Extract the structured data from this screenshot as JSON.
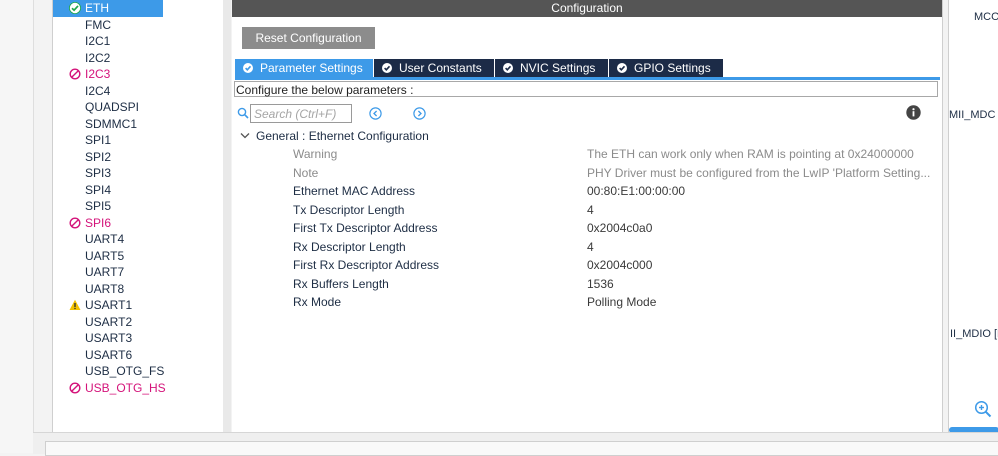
{
  "sidebar": {
    "items": [
      {
        "label": "ETH",
        "state": "selected",
        "icon": "check-circle-icon"
      },
      {
        "label": "FMC",
        "state": "normal",
        "icon": ""
      },
      {
        "label": "I2C1",
        "state": "normal",
        "icon": ""
      },
      {
        "label": "I2C2",
        "state": "normal",
        "icon": ""
      },
      {
        "label": "I2C3",
        "state": "disabled",
        "icon": "no-entry-icon"
      },
      {
        "label": "I2C4",
        "state": "normal",
        "icon": ""
      },
      {
        "label": "QUADSPI",
        "state": "normal",
        "icon": ""
      },
      {
        "label": "SDMMC1",
        "state": "normal",
        "icon": ""
      },
      {
        "label": "SPI1",
        "state": "normal",
        "icon": ""
      },
      {
        "label": "SPI2",
        "state": "normal",
        "icon": ""
      },
      {
        "label": "SPI3",
        "state": "normal",
        "icon": ""
      },
      {
        "label": "SPI4",
        "state": "normal",
        "icon": ""
      },
      {
        "label": "SPI5",
        "state": "normal",
        "icon": ""
      },
      {
        "label": "SPI6",
        "state": "disabled",
        "icon": "no-entry-icon"
      },
      {
        "label": "UART4",
        "state": "normal",
        "icon": ""
      },
      {
        "label": "UART5",
        "state": "normal",
        "icon": ""
      },
      {
        "label": "UART7",
        "state": "normal",
        "icon": ""
      },
      {
        "label": "UART8",
        "state": "normal",
        "icon": ""
      },
      {
        "label": "USART1",
        "state": "warning",
        "icon": "warning-triangle-icon"
      },
      {
        "label": "USART2",
        "state": "normal",
        "icon": ""
      },
      {
        "label": "USART3",
        "state": "normal",
        "icon": ""
      },
      {
        "label": "USART6",
        "state": "normal",
        "icon": ""
      },
      {
        "label": "USB_OTG_FS",
        "state": "normal",
        "icon": ""
      },
      {
        "label": "USB_OTG_HS",
        "state": "disabled",
        "icon": "no-entry-icon"
      }
    ]
  },
  "config": {
    "title": "Configuration",
    "reset_label": "Reset Configuration",
    "tabs": [
      {
        "label": "Parameter Settings",
        "active": true
      },
      {
        "label": "User Constants",
        "active": false
      },
      {
        "label": "NVIC Settings",
        "active": false
      },
      {
        "label": "GPIO Settings",
        "active": false
      }
    ],
    "description": "Configure the below parameters :",
    "search_placeholder": "Search (Ctrl+F)",
    "group_label": "General : Ethernet Configuration",
    "params": [
      {
        "name": "Warning",
        "value": "The ETH can work only when RAM is pointing at 0x24000000",
        "muted": true
      },
      {
        "name": "Note",
        "value": "PHY Driver must be configured from the LwIP 'Platform Setting...",
        "muted": true
      },
      {
        "name": "Ethernet MAC Address",
        "value": "00:80:E1:00:00:00",
        "muted": false
      },
      {
        "name": "Tx Descriptor Length",
        "value": "4",
        "muted": false
      },
      {
        "name": "First Tx Descriptor Address",
        "value": "0x2004c0a0",
        "muted": false
      },
      {
        "name": "Rx Descriptor Length",
        "value": "4",
        "muted": false
      },
      {
        "name": "First Rx Descriptor Address",
        "value": "0x2004c000",
        "muted": false
      },
      {
        "name": "Rx Buffers Length",
        "value": "1536",
        "muted": false
      },
      {
        "name": "Rx Mode",
        "value": "Polling Mode",
        "muted": false
      }
    ]
  },
  "pinout": {
    "labels": [
      "MCO",
      "MII_MDC [",
      "II_MDIO [L"
    ]
  },
  "colors": {
    "accent": "#3d9ae8",
    "tab_dark": "#1c2b47",
    "header": "#555555",
    "disabled": "#d4137a",
    "warning": "#f2c200",
    "ok": "#1ea84a"
  }
}
